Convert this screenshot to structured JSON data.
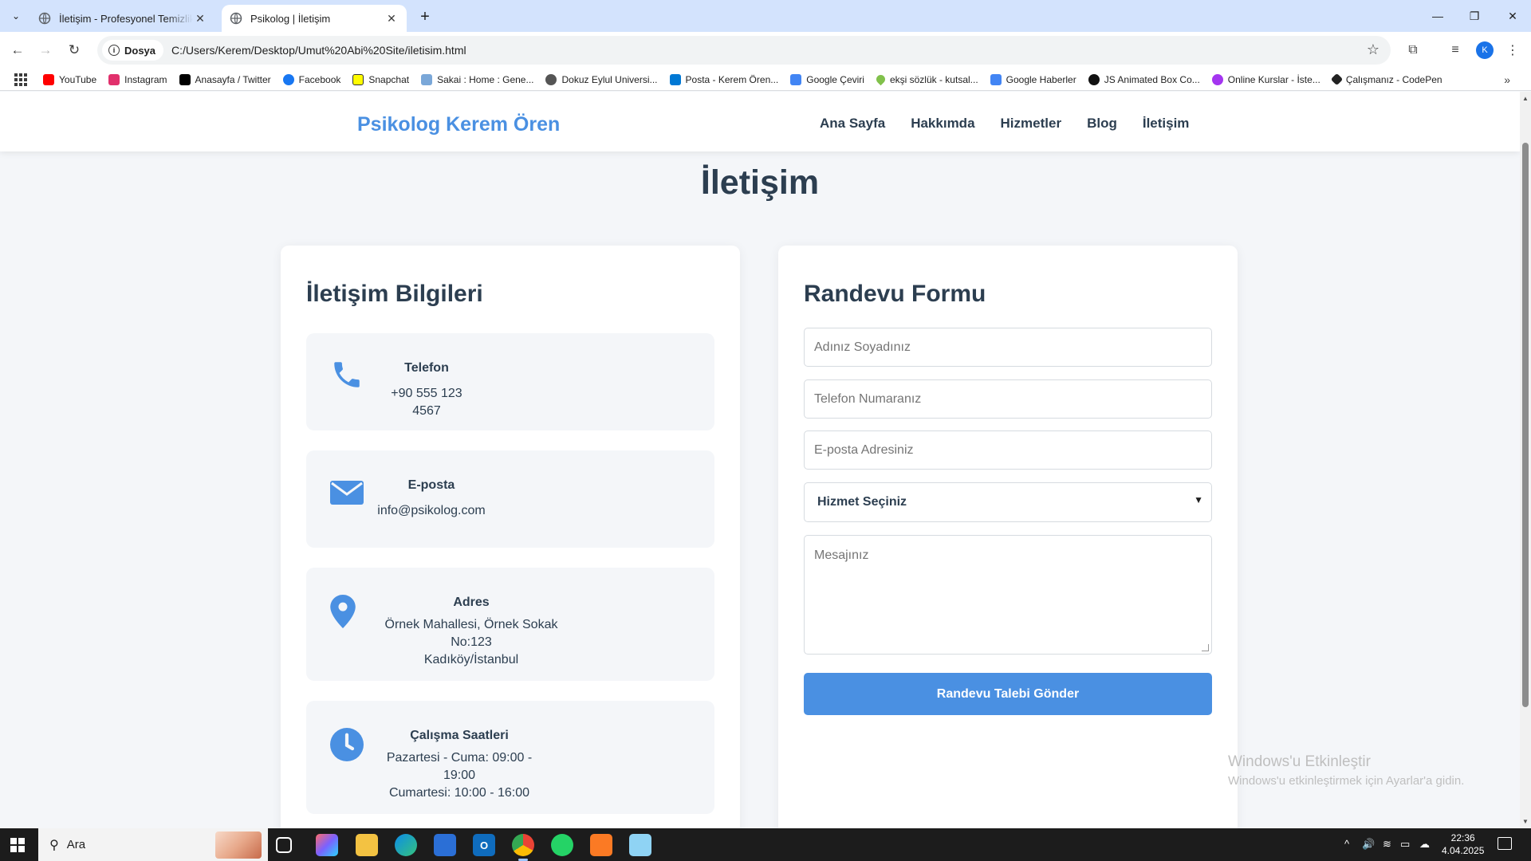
{
  "browser": {
    "tabs": [
      {
        "title": "İletişim - Profesyonel Temizlik Hizmetleri",
        "active": false
      },
      {
        "title": "Psikolog | İletişim",
        "active": true
      }
    ],
    "address": {
      "chip": "Dosya",
      "url": "C:/Users/Kerem/Desktop/Umut%20Abi%20Site/iletisim.html"
    },
    "profile_initial": "K",
    "bookmarks": [
      {
        "label": "YouTube",
        "color": "#ff0000"
      },
      {
        "label": "Instagram",
        "color": "#e1306c"
      },
      {
        "label": "Anasayfa / Twitter",
        "color": "#000000"
      },
      {
        "label": "Facebook",
        "color": "#1877f2"
      },
      {
        "label": "Snapchat",
        "color": "#fffc00"
      },
      {
        "label": "Sakai : Home : Gene...",
        "color": "#7aa7d8"
      },
      {
        "label": "Dokuz Eylul Universi...",
        "color": "#555555"
      },
      {
        "label": "Posta - Kerem Ören...",
        "color": "#0078d4"
      },
      {
        "label": "Google Çeviri",
        "color": "#4285f4"
      },
      {
        "label": "ekşi sözlük - kutsal...",
        "color": "#81c14b"
      },
      {
        "label": "Google Haberler",
        "color": "#4285f4"
      },
      {
        "label": "JS Animated Box Co...",
        "color": "#111111"
      },
      {
        "label": "Online Kurslar - İste...",
        "color": "#a435f0"
      },
      {
        "label": "Çalışmanız - CodePen",
        "color": "#222222"
      }
    ]
  },
  "site": {
    "logo": "Psikolog Kerem Ören",
    "nav": [
      "Ana Sayfa",
      "Hakkımda",
      "Hizmetler",
      "Blog",
      "İletişim"
    ],
    "page_title": "İletişim",
    "contact": {
      "heading": "İletişim Bilgileri",
      "phone": {
        "label": "Telefon",
        "value": "+90 555 123 4567",
        "icon": "phone-icon"
      },
      "email": {
        "label": "E-posta",
        "value": "info@psikolog.com",
        "icon": "envelope-icon"
      },
      "address": {
        "label": "Adres",
        "line1": "Örnek Mahallesi, Örnek Sokak No:123",
        "line2": "Kadıköy/İstanbul",
        "icon": "map-pin-icon"
      },
      "hours": {
        "label": "Çalışma Saatleri",
        "line1": "Pazartesi - Cuma: 09:00 - 19:00",
        "line2": "Cumartesi: 10:00 - 16:00",
        "icon": "clock-icon"
      }
    },
    "form": {
      "heading": "Randevu Formu",
      "name_placeholder": "Adınız Soyadınız",
      "phone_placeholder": "Telefon Numaranız",
      "email_placeholder": "E-posta Adresiniz",
      "service_selected": "Hizmet Seçiniz",
      "message_placeholder": "Mesajınız",
      "submit_label": "Randevu Talebi Gönder"
    },
    "accent_color": "#4a90e2"
  },
  "watermark": {
    "line1": "Windows'u Etkinleştir",
    "line2": "Windows'u etkinleştirmek için Ayarlar'a gidin."
  },
  "taskbar": {
    "search_label": "Ara",
    "time": "22:36",
    "date": "4.04.2025"
  }
}
